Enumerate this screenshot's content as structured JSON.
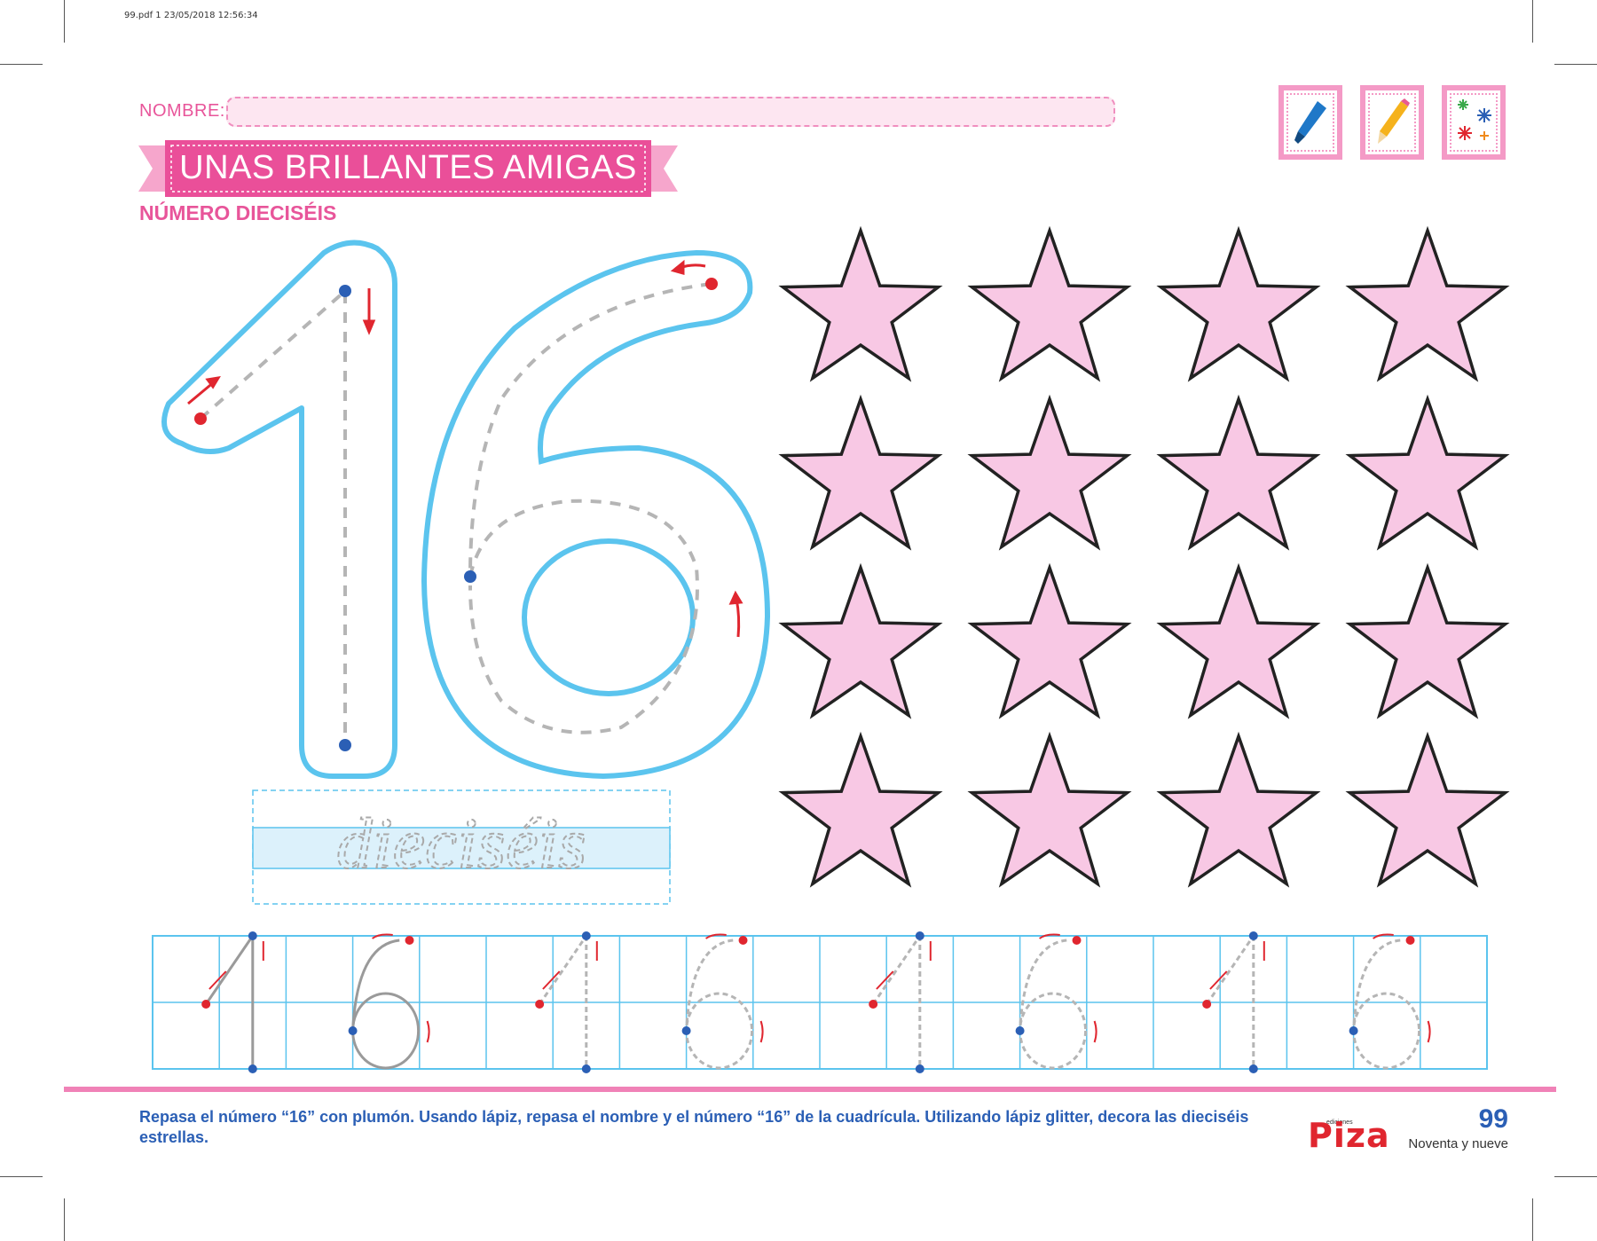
{
  "header": {
    "print_meta": "99.pdf   1   23/05/2018   12:56:34"
  },
  "form": {
    "name_label": "NOMBRE:",
    "name_value": ""
  },
  "title": "UNAS BRILLANTES AMIGAS",
  "subtitle": "NÚMERO DIECISÉIS",
  "tools": [
    "marker-icon",
    "pencil-icon",
    "glitter-icon"
  ],
  "big_number": "16",
  "word_trace": "dieciséis",
  "stars": {
    "rows": 4,
    "cols": 4,
    "fill": "#f8c8e4",
    "stroke": "#222222"
  },
  "practice_grid": {
    "number": "16",
    "repetitions": 4
  },
  "colors": {
    "pink": "#e8559a",
    "outline_blue": "#5bc4ee",
    "arrow_red": "#e0262f",
    "dot_blue": "#2b5fb5",
    "text_blue": "#2b5fb5"
  },
  "footer": {
    "instructions": "Repasa el número “16” con plumón. Usando lápiz, repasa el nombre y el número “16” de la cuadrícula. Utilizando lápiz glitter, decora las dieciséis estrellas.",
    "publisher": "Piza",
    "publisher_prefix": "ediciones",
    "page_number": "99",
    "page_word": "Noventa y nueve"
  }
}
